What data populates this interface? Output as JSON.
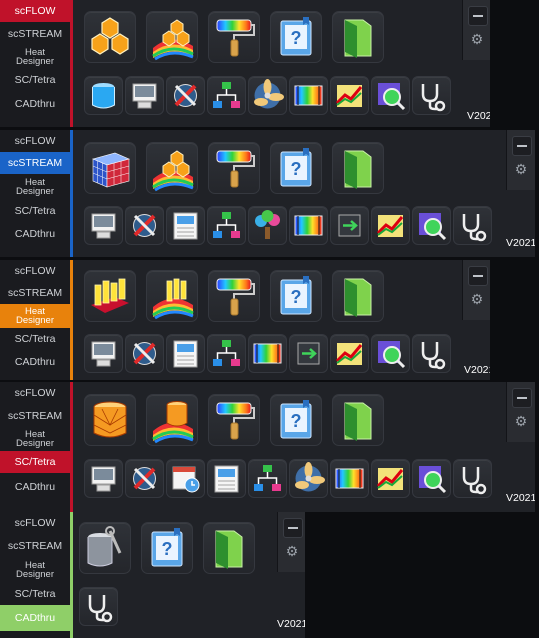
{
  "tab_labels": {
    "scflow": "scFLOW",
    "scstream": "scSTREAM",
    "heat_designer": [
      "Heat",
      "Designer"
    ],
    "sctetra": "SC/Tetra",
    "cadthru": "CADthru"
  },
  "version": "V2021",
  "colors": {
    "scflow": "#c0122a",
    "scstream": "#1a64c8",
    "heat_designer": "#e8820c",
    "sctetra": "#c0122a",
    "cadthru": "#8fcf68"
  },
  "panels": [
    {
      "active_tab": "scflow",
      "big_icons": [
        "mesh-cells-icon",
        "mesh-on-flow-icon",
        "paint-roller-icon",
        "help-book-icon",
        "green-folder-icon"
      ],
      "small_icons": [
        "blue-cylinder-icon",
        "monitor-icon",
        "tools-cross-icon",
        "flowchart-icon",
        "fan-icon",
        "color-bar-icon",
        "graph-arrow-icon",
        "magnify-grid-icon",
        "stethoscope-icon"
      ]
    },
    {
      "active_tab": "scstream",
      "big_icons": [
        "voxel-cube-icon",
        "mesh-on-flow-icon",
        "paint-roller-icon",
        "help-book-icon",
        "green-folder-icon"
      ],
      "small_icons": [
        "monitor-icon",
        "tools-cross-icon",
        "table-chart-icon",
        "flowchart-icon",
        "tree-icon",
        "color-bar-icon",
        "chip-arrow-icon",
        "graph-arrow-icon",
        "magnify-grid-icon",
        "stethoscope-icon"
      ]
    },
    {
      "active_tab": "heat_designer",
      "big_icons": [
        "component-board-icon",
        "components-on-flow-icon",
        "paint-roller-icon",
        "help-book-icon",
        "green-folder-icon"
      ],
      "small_icons": [
        "monitor-icon",
        "tools-cross-icon",
        "table-chart-icon",
        "flowchart-icon",
        "color-bar-icon",
        "chip-arrow-icon",
        "graph-arrow-icon",
        "magnify-grid-icon",
        "stethoscope-icon"
      ]
    },
    {
      "active_tab": "sctetra",
      "big_icons": [
        "tetra-drum-icon",
        "tetra-on-flow-icon",
        "paint-roller-icon",
        "help-book-icon",
        "green-folder-icon"
      ],
      "small_icons": [
        "monitor-icon",
        "tools-cross-icon",
        "calendar-clock-icon",
        "table-chart-icon",
        "flowchart-icon",
        "fan-icon",
        "color-bar-icon",
        "graph-arrow-icon",
        "magnify-grid-icon",
        "stethoscope-icon"
      ]
    },
    {
      "active_tab": "cadthru",
      "big_icons": [
        "toolbox-icon",
        "help-book-icon",
        "green-folder-icon"
      ],
      "small_icons": [
        "stethoscope-icon"
      ]
    }
  ]
}
